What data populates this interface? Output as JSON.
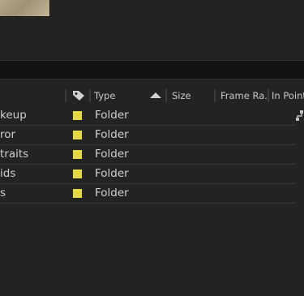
{
  "columns": {
    "type_label": "Type",
    "size_label": "Size",
    "frame_rate_label": "Frame Ra...",
    "in_point_label": "In Point"
  },
  "icons": {
    "label_column": "tag-icon",
    "sort": "sort-ascending-icon",
    "flowchart": "flowchart-icon"
  },
  "colors": {
    "label_yellow": "#e6d84a",
    "background": "#232323",
    "search_bar": "#121212"
  },
  "rows": [
    {
      "name": "keup",
      "type": "Folder"
    },
    {
      "name": "ror",
      "type": "Folder"
    },
    {
      "name": "traits",
      "type": "Folder"
    },
    {
      "name": "ids",
      "type": "Folder"
    },
    {
      "name": "s",
      "type": "Folder"
    }
  ]
}
